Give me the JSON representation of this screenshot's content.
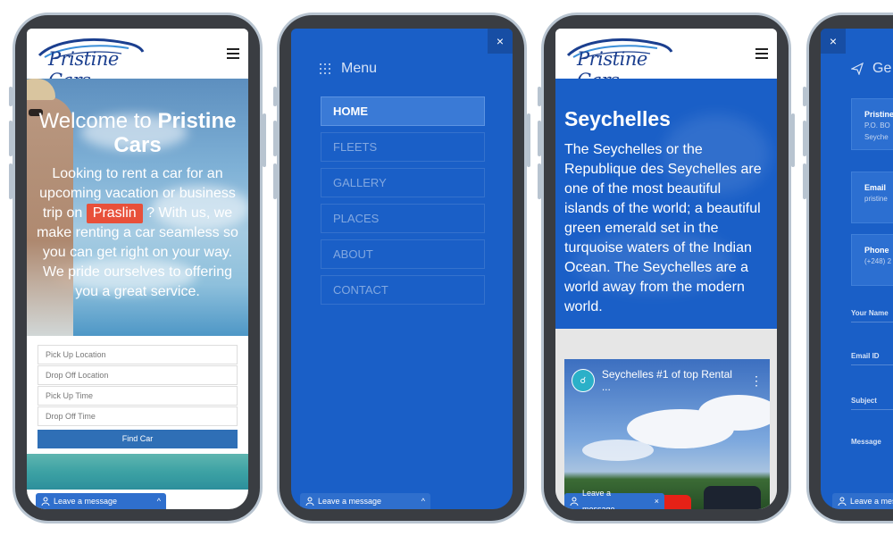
{
  "brand": {
    "logo_text": "Pristine Cars"
  },
  "chat": {
    "label": "Leave a message"
  },
  "home": {
    "welcome_prefix": "Welcome to",
    "welcome_brand": "Pristine Cars",
    "body_before": "Looking to rent a car for an upcoming vacation or business trip on",
    "highlight": "Praslin",
    "body_after": "? With us, we make renting a car seamless so you can get right on your way. We pride ourselves to offering you a great service.",
    "form": {
      "pickup_location": "Pick Up Location",
      "dropoff_location": "Drop Off Location",
      "pickup_time": "Pick Up Time",
      "dropoff_time": "Drop Off Time",
      "submit": "Find Car"
    }
  },
  "menu": {
    "close": "×",
    "title": "Menu",
    "items": [
      {
        "label": "HOME"
      },
      {
        "label": "FLEETS"
      },
      {
        "label": "GALLERY"
      },
      {
        "label": "PLACES"
      },
      {
        "label": "ABOUT"
      },
      {
        "label": "CONTACT"
      }
    ]
  },
  "place": {
    "title": "Seychelles",
    "body": "The Seychelles or the Republique des Seychelles are one of the most beautiful islands of the world; a beautiful green emerald set in the turquoise waters of the Indian Ocean. The Seychelles are a world away from the modern world.",
    "video_title": "Seychelles #1 of top Rental ..."
  },
  "contact": {
    "close": "×",
    "heading": "Ge",
    "cards": [
      {
        "title": "Pristine",
        "lines": [
          "P.O. BO",
          "Seyche"
        ]
      },
      {
        "title": "Email",
        "lines": [
          "pristine"
        ]
      },
      {
        "title": "Phone",
        "lines": [
          "(+248) 2"
        ]
      }
    ],
    "fields": [
      "Your Name",
      "Email ID",
      "Subject",
      "Message"
    ],
    "chat_label": "Leave a mes"
  }
}
